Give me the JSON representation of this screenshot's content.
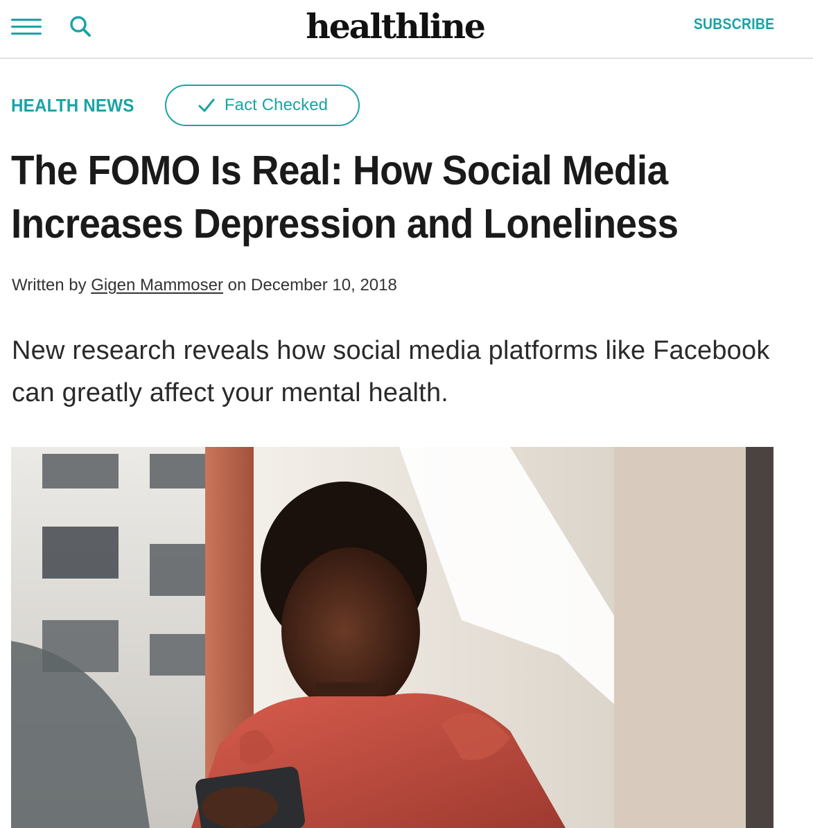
{
  "colors": {
    "accent": "#1aa3a6",
    "text": "#1a1a1a"
  },
  "header": {
    "menu_icon": "hamburger-menu-icon",
    "search_icon": "search-icon",
    "logo_text": "healthline",
    "subscribe_label": "SUBSCRIBE"
  },
  "article": {
    "category": "HEALTH NEWS",
    "fact_check_icon": "checkmark-icon",
    "fact_check_label": "Fact Checked",
    "title": "The FOMO Is Real: How Social Media Increases Depression and Loneliness",
    "byline": {
      "prefix": "Written by",
      "author": "Gigen Mammoser",
      "date_prefix": "on",
      "date": "December 10, 2018"
    },
    "dek": "New research reveals how social media platforms like Facebook can greatly affect your mental health."
  }
}
